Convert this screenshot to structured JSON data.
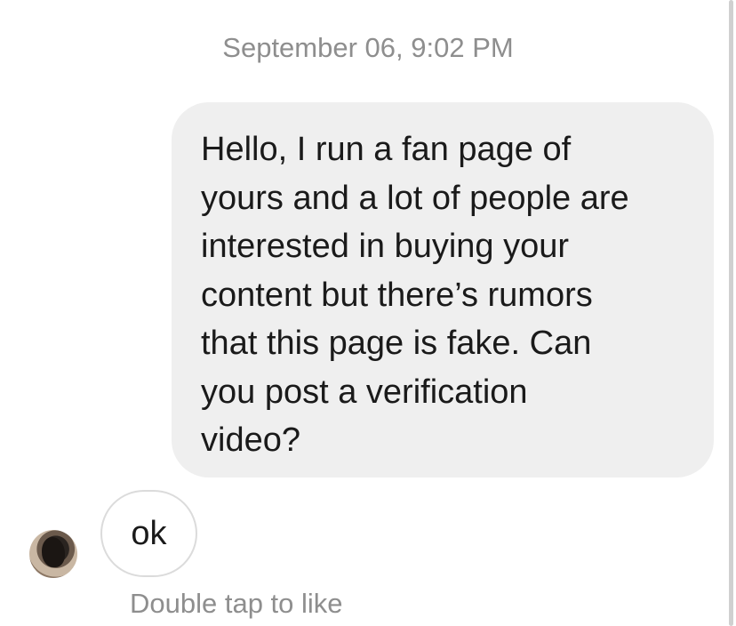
{
  "conversation": {
    "timestamp": "September 06, 9:02 PM",
    "sent_message": "Hello, I run a fan page of\nyours and a lot of people are\ninterested in buying your\ncontent but there’s rumors\nthat this page is fake. Can\nyou post a verification\nvideo?",
    "received_message": "ok",
    "like_hint": "Double tap to like"
  }
}
